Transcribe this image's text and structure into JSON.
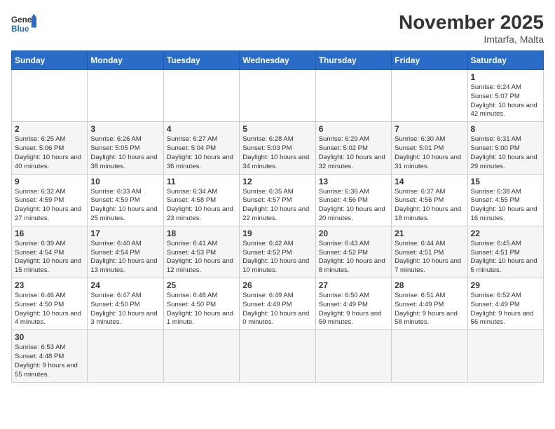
{
  "header": {
    "logo_general": "General",
    "logo_blue": "Blue",
    "month_title": "November 2025",
    "location": "Imtarfa, Malta"
  },
  "days_of_week": [
    "Sunday",
    "Monday",
    "Tuesday",
    "Wednesday",
    "Thursday",
    "Friday",
    "Saturday"
  ],
  "weeks": [
    [
      {
        "day": "",
        "info": ""
      },
      {
        "day": "",
        "info": ""
      },
      {
        "day": "",
        "info": ""
      },
      {
        "day": "",
        "info": ""
      },
      {
        "day": "",
        "info": ""
      },
      {
        "day": "",
        "info": ""
      },
      {
        "day": "1",
        "info": "Sunrise: 6:24 AM\nSunset: 5:07 PM\nDaylight: 10 hours and 42 minutes."
      }
    ],
    [
      {
        "day": "2",
        "info": "Sunrise: 6:25 AM\nSunset: 5:06 PM\nDaylight: 10 hours and 40 minutes."
      },
      {
        "day": "3",
        "info": "Sunrise: 6:26 AM\nSunset: 5:05 PM\nDaylight: 10 hours and 38 minutes."
      },
      {
        "day": "4",
        "info": "Sunrise: 6:27 AM\nSunset: 5:04 PM\nDaylight: 10 hours and 36 minutes."
      },
      {
        "day": "5",
        "info": "Sunrise: 6:28 AM\nSunset: 5:03 PM\nDaylight: 10 hours and 34 minutes."
      },
      {
        "day": "6",
        "info": "Sunrise: 6:29 AM\nSunset: 5:02 PM\nDaylight: 10 hours and 32 minutes."
      },
      {
        "day": "7",
        "info": "Sunrise: 6:30 AM\nSunset: 5:01 PM\nDaylight: 10 hours and 31 minutes."
      },
      {
        "day": "8",
        "info": "Sunrise: 6:31 AM\nSunset: 5:00 PM\nDaylight: 10 hours and 29 minutes."
      }
    ],
    [
      {
        "day": "9",
        "info": "Sunrise: 6:32 AM\nSunset: 4:59 PM\nDaylight: 10 hours and 27 minutes."
      },
      {
        "day": "10",
        "info": "Sunrise: 6:33 AM\nSunset: 4:59 PM\nDaylight: 10 hours and 25 minutes."
      },
      {
        "day": "11",
        "info": "Sunrise: 6:34 AM\nSunset: 4:58 PM\nDaylight: 10 hours and 23 minutes."
      },
      {
        "day": "12",
        "info": "Sunrise: 6:35 AM\nSunset: 4:57 PM\nDaylight: 10 hours and 22 minutes."
      },
      {
        "day": "13",
        "info": "Sunrise: 6:36 AM\nSunset: 4:56 PM\nDaylight: 10 hours and 20 minutes."
      },
      {
        "day": "14",
        "info": "Sunrise: 6:37 AM\nSunset: 4:56 PM\nDaylight: 10 hours and 18 minutes."
      },
      {
        "day": "15",
        "info": "Sunrise: 6:38 AM\nSunset: 4:55 PM\nDaylight: 10 hours and 16 minutes."
      }
    ],
    [
      {
        "day": "16",
        "info": "Sunrise: 6:39 AM\nSunset: 4:54 PM\nDaylight: 10 hours and 15 minutes."
      },
      {
        "day": "17",
        "info": "Sunrise: 6:40 AM\nSunset: 4:54 PM\nDaylight: 10 hours and 13 minutes."
      },
      {
        "day": "18",
        "info": "Sunrise: 6:41 AM\nSunset: 4:53 PM\nDaylight: 10 hours and 12 minutes."
      },
      {
        "day": "19",
        "info": "Sunrise: 6:42 AM\nSunset: 4:52 PM\nDaylight: 10 hours and 10 minutes."
      },
      {
        "day": "20",
        "info": "Sunrise: 6:43 AM\nSunset: 4:52 PM\nDaylight: 10 hours and 8 minutes."
      },
      {
        "day": "21",
        "info": "Sunrise: 6:44 AM\nSunset: 4:51 PM\nDaylight: 10 hours and 7 minutes."
      },
      {
        "day": "22",
        "info": "Sunrise: 6:45 AM\nSunset: 4:51 PM\nDaylight: 10 hours and 5 minutes."
      }
    ],
    [
      {
        "day": "23",
        "info": "Sunrise: 6:46 AM\nSunset: 4:50 PM\nDaylight: 10 hours and 4 minutes."
      },
      {
        "day": "24",
        "info": "Sunrise: 6:47 AM\nSunset: 4:50 PM\nDaylight: 10 hours and 3 minutes."
      },
      {
        "day": "25",
        "info": "Sunrise: 6:48 AM\nSunset: 4:50 PM\nDaylight: 10 hours and 1 minute."
      },
      {
        "day": "26",
        "info": "Sunrise: 6:49 AM\nSunset: 4:49 PM\nDaylight: 10 hours and 0 minutes."
      },
      {
        "day": "27",
        "info": "Sunrise: 6:50 AM\nSunset: 4:49 PM\nDaylight: 9 hours and 59 minutes."
      },
      {
        "day": "28",
        "info": "Sunrise: 6:51 AM\nSunset: 4:49 PM\nDaylight: 9 hours and 58 minutes."
      },
      {
        "day": "29",
        "info": "Sunrise: 6:52 AM\nSunset: 4:49 PM\nDaylight: 9 hours and 56 minutes."
      }
    ],
    [
      {
        "day": "30",
        "info": "Sunrise: 6:53 AM\nSunset: 4:48 PM\nDaylight: 9 hours and 55 minutes."
      },
      {
        "day": "",
        "info": ""
      },
      {
        "day": "",
        "info": ""
      },
      {
        "day": "",
        "info": ""
      },
      {
        "day": "",
        "info": ""
      },
      {
        "day": "",
        "info": ""
      },
      {
        "day": "",
        "info": ""
      }
    ]
  ]
}
